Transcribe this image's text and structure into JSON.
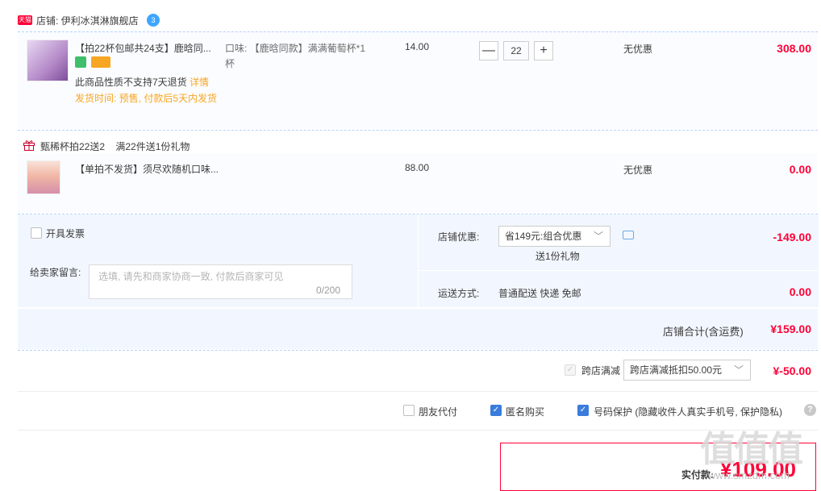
{
  "shop": {
    "badge": "天猫",
    "label": "店铺: 伊利冰淇淋旗舰店",
    "chat_badge": "3"
  },
  "item1": {
    "title": "【拍22杯包邮共24支】鹿晗同...",
    "sku": "口味: 【鹿晗同款】满满葡萄杯*1杯",
    "no_return": "此商品性质不支持7天退货",
    "details_link": "详情",
    "ship_time": "发货时间: 预售, 付款后5天内发货",
    "price": "14.00",
    "qty": "22",
    "qty_minus": "—",
    "qty_plus": "+",
    "promo": "无优惠",
    "subtotal": "308.00"
  },
  "gift": {
    "text": "甄稀杯拍22送2    满22件送1份礼物"
  },
  "item2": {
    "title": "【单拍不发货】须尽欢随机口味...",
    "price": "88.00",
    "promo": "无优惠",
    "subtotal": "0.00"
  },
  "invoice": {
    "label": "开具发票"
  },
  "message": {
    "label": "给卖家留言:",
    "placeholder": "选填, 请先和商家协商一致, 付款后商家可见",
    "count": "0/200"
  },
  "shop_discount": {
    "label": "店铺优惠:",
    "selected": "省149元:组合优惠",
    "chevron": "﹀",
    "gift_note": "送1份礼物",
    "amount": "-149.00"
  },
  "shipping": {
    "label": "运送方式:",
    "value": "普通配送 快递 免邮",
    "amount": "0.00"
  },
  "shop_total": {
    "label": "店铺合计(含运费)",
    "amount": "¥159.00"
  },
  "cross_store": {
    "label": "跨店满减",
    "selected": "跨店满减抵扣50.00元",
    "amount": "¥-50.00"
  },
  "options": {
    "friend_pay": "朋友代付",
    "anonymous": "匿名购买",
    "number_protect": "号码保护 (隐藏收件人真实手机号, 保护隐私)",
    "check": "✓",
    "help": "?"
  },
  "pay": {
    "label": "实付款:",
    "amount": "¥109.00"
  },
  "watermark": {
    "logo": "值值值",
    "url": "www.smzdm.com"
  }
}
